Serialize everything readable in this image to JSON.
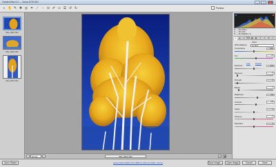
{
  "window": {
    "title": "Camera Raw 6.0  —  Canon EOS 40D",
    "controls": [
      "–",
      "□",
      "×"
    ]
  },
  "toolbar": {
    "tools": [
      "zoom-icon",
      "hand-icon",
      "white-balance-icon",
      "color-sampler-icon",
      "target-adjust-icon",
      "crop-icon",
      "straighten-icon",
      "spot-removal-icon",
      "red-eye-icon",
      "adjustment-brush-icon",
      "graduated-filter-icon",
      "preferences-icon",
      "rotate-left-icon",
      "rotate-right-icon"
    ],
    "tool_glyphs": [
      "⌕",
      "✋",
      "✎",
      "✚",
      "◎",
      "⌗",
      "⟋",
      "◌",
      "⊙",
      "✐",
      "▭",
      "☰",
      "↺",
      "↻"
    ],
    "preview_label": "Preview"
  },
  "filmstrip": {
    "thumbs": [
      {
        "caption": "IMG_0001.CR2",
        "kind": "blue-sky",
        "selected": true
      },
      {
        "caption": "IMG_0002.CR2",
        "kind": "blue-wide",
        "selected": false
      },
      {
        "caption": "IMG_0003.CR2",
        "kind": "trees",
        "selected": false
      }
    ]
  },
  "canvas": {
    "zoom": "20.5%",
    "filename": "IMG_0001.CR2"
  },
  "panel": {
    "readout": [
      "R: ---   f/8   1/250 s",
      "G: ---   ISO 100",
      "B: ---   24-105@50 mm"
    ],
    "tabs": [
      "◐",
      "▲",
      "≡",
      "HSL",
      "▦",
      "◧",
      "ƒ",
      "✦",
      "⚙",
      "☐"
    ],
    "section_title": "Basic",
    "white_balance": {
      "label": "White Balance:",
      "value": "As Shot"
    },
    "params": [
      {
        "label": "Temperature",
        "value": "5000",
        "colors": [
          "#3b6ed8",
          "#f1d23a"
        ],
        "level": 0.5
      },
      {
        "label": "Tint",
        "value": "+5",
        "colors": [
          "#3fb84a",
          "#d63fd6"
        ],
        "level": 0.55
      },
      {
        "label": "Exposure",
        "value": "0.00",
        "colors": [
          "#777",
          "#f4f4f4"
        ],
        "level": 0.5
      },
      {
        "label": "Recovery",
        "value": "0",
        "colors": [
          "#e8e8e8",
          "#777"
        ],
        "level": 0.05
      },
      {
        "label": "Fill Light",
        "value": "0",
        "colors": [
          "#777",
          "#e8e8e8"
        ],
        "level": 0.05
      },
      {
        "label": "Blacks",
        "value": "5",
        "colors": [
          "#e8e8e8",
          "#444"
        ],
        "level": 0.1
      },
      {
        "label": "Brightness",
        "value": "+50",
        "colors": [
          "#777",
          "#f4f4f4"
        ],
        "level": 0.6
      },
      {
        "label": "Contrast",
        "value": "+25",
        "colors": [
          "#777",
          "#f4f4f4"
        ],
        "level": 0.55
      },
      {
        "label": "Clarity",
        "value": "0",
        "colors": [
          "#999",
          "#eee"
        ],
        "level": 0.5
      },
      {
        "label": "Vibrance",
        "value": "0",
        "colors": [
          "#999",
          "#d94b8a"
        ],
        "level": 0.5
      },
      {
        "label": "Saturation",
        "value": "0",
        "colors": [
          "#999",
          "#d94b8a"
        ],
        "level": 0.5
      }
    ],
    "auto_label": "Auto",
    "default_label": "Default"
  },
  "bottom": {
    "open_object_label": "Open Object",
    "workflow_link": "Adobe RGB (1998); 8 bit; 3888 by 2592 (10.1MP); 240 ppi",
    "save_label": "Save Image...",
    "open_image_label": "Open Image",
    "cancel_label": "Cancel",
    "done_label": "Done"
  },
  "colors": {
    "sky_top": "#0a1d7d",
    "sky_bottom": "#2a57c6",
    "foliage": "#e7a81d",
    "accent_link": "#2a5bd7"
  }
}
